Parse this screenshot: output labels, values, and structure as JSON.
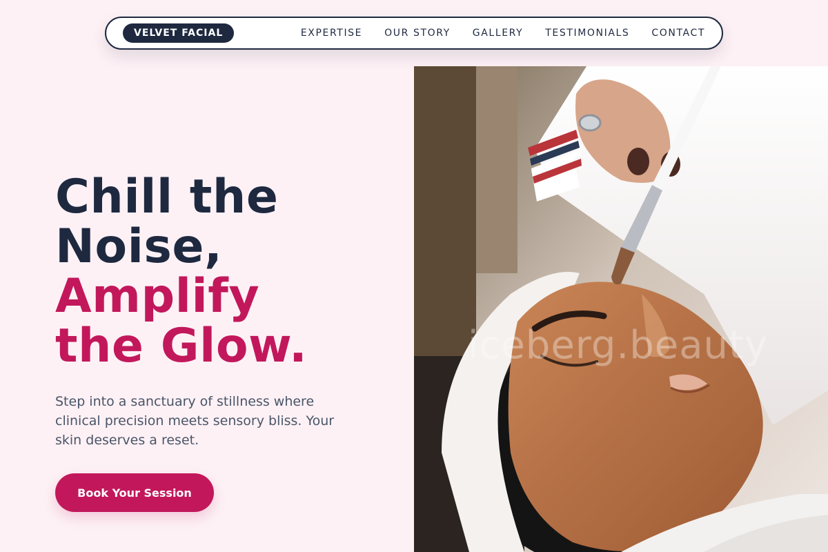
{
  "nav": {
    "brand": "VELVET FACIAL",
    "links": [
      "EXPERTISE",
      "OUR STORY",
      "GALLERY",
      "TESTIMONIALS",
      "CONTACT"
    ]
  },
  "hero": {
    "headline_line1": "Chill the",
    "headline_line2": "Noise,",
    "headline_line3": "Amplify",
    "headline_line4": "the Glow.",
    "subcopy": "Step into a sanctuary of stillness where clinical precision meets sensory bliss. Your skin deserves a reset.",
    "cta_label": "Book Your Session",
    "image_watermark": "iceberg.beauty"
  },
  "colors": {
    "page_background": "#fdf1f5",
    "navy": "#1e2940",
    "accent": "#c2185b",
    "body_text": "#4a5568"
  }
}
